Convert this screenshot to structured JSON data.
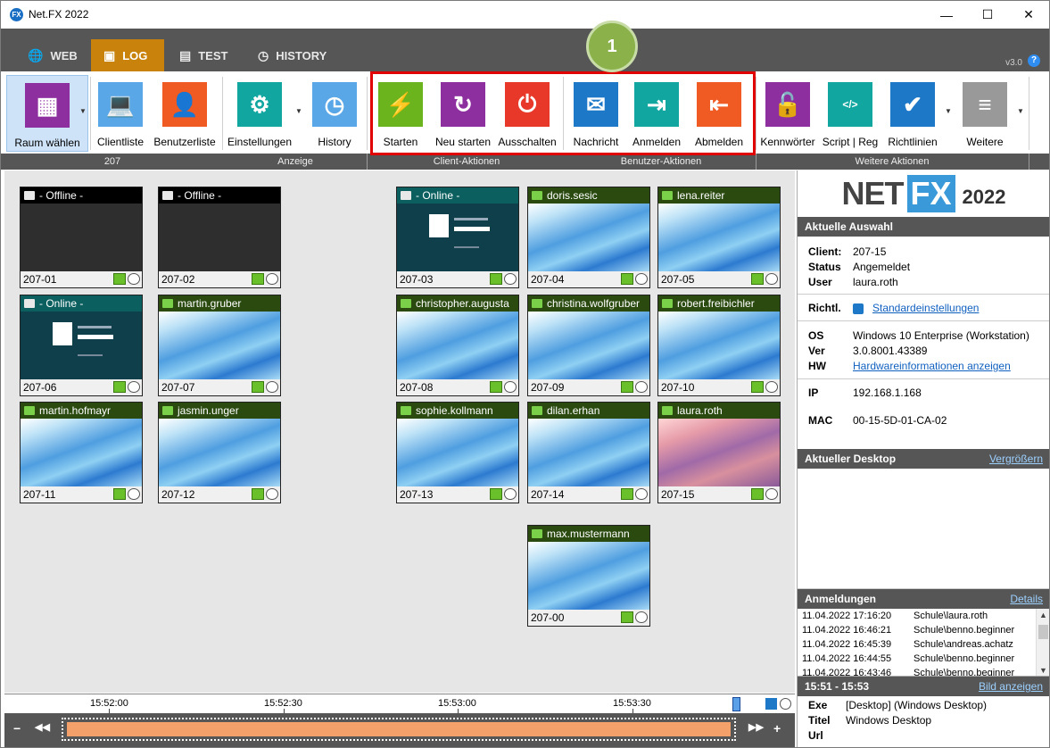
{
  "window": {
    "title": "Net.FX 2022",
    "icon": "netfx-app-icon"
  },
  "window_controls": {
    "minimize": "—",
    "maximize": "☐",
    "close": "✕"
  },
  "tabs": [
    {
      "label": "WEB",
      "icon": "globe-icon",
      "active": false
    },
    {
      "label": "LOG",
      "icon": "log-icon",
      "active": true
    },
    {
      "label": "TEST",
      "icon": "test-icon",
      "active": false
    },
    {
      "label": "HISTORY",
      "icon": "history-icon",
      "active": false
    }
  ],
  "version": "v3.0",
  "help": "?",
  "callout_badge": "1",
  "ribbon": {
    "buttons": [
      {
        "label": "Raum wählen",
        "icon": "room-icon",
        "color": "#8e2fa0"
      },
      {
        "label": "Clientliste",
        "icon": "laptop-icon",
        "color": "#5aa7e8"
      },
      {
        "label": "Benutzerliste",
        "icon": "user-icon",
        "color": "#f05a23"
      },
      {
        "label": "Einstellungen",
        "icon": "gears-icon",
        "color": "#11a6a0"
      },
      {
        "label": "History",
        "icon": "history-globe-icon",
        "color": "#5aa7e8"
      },
      {
        "label": "Starten",
        "icon": "lightning-icon",
        "color": "#6cb41e"
      },
      {
        "label": "Neu starten",
        "icon": "restart-icon",
        "color": "#8e2fa0"
      },
      {
        "label": "Ausschalten",
        "icon": "power-icon",
        "color": "#e8382a"
      },
      {
        "label": "Nachricht",
        "icon": "envelope-icon",
        "color": "#1e78c8"
      },
      {
        "label": "Anmelden",
        "icon": "login-icon",
        "color": "#11a6a0"
      },
      {
        "label": "Abmelden",
        "icon": "logout-icon",
        "color": "#f05a23"
      },
      {
        "label": "Kennwörter",
        "icon": "lock-icon",
        "color": "#8e2fa0"
      },
      {
        "label": "Script | Reg",
        "icon": "code-icon",
        "color": "#11a6a0"
      },
      {
        "label": "Richtlinien",
        "icon": "shield-check-icon",
        "color": "#1e78c8"
      },
      {
        "label": "Weitere",
        "icon": "menu-icon",
        "color": "#999999"
      }
    ],
    "groups": [
      "207",
      "Anzeige",
      "Client-Aktionen",
      "Benutzer-Aktionen",
      "Weitere Aktionen"
    ]
  },
  "clients": [
    {
      "id": "207-01",
      "header": "- Offline -",
      "state": "offline",
      "screen": "dark"
    },
    {
      "id": "207-02",
      "header": "- Offline -",
      "state": "offline",
      "screen": "dark"
    },
    {
      "id": "207-03",
      "header": "- Online -",
      "state": "online",
      "screen": "teal"
    },
    {
      "id": "207-04",
      "header": "doris.sesic",
      "state": "user",
      "screen": "blue"
    },
    {
      "id": "207-05",
      "header": "lena.reiter",
      "state": "user",
      "screen": "blue"
    },
    {
      "id": "207-06",
      "header": "- Online -",
      "state": "online",
      "screen": "teal"
    },
    {
      "id": "207-07",
      "header": "martin.gruber",
      "state": "user",
      "screen": "blue"
    },
    {
      "id": "207-08",
      "header": "christopher.augusta",
      "state": "user",
      "screen": "blue"
    },
    {
      "id": "207-09",
      "header": "christina.wolfgruber",
      "state": "user",
      "screen": "blue"
    },
    {
      "id": "207-10",
      "header": "robert.freibichler",
      "state": "user",
      "screen": "blue"
    },
    {
      "id": "207-11",
      "header": "martin.hofmayr",
      "state": "user",
      "screen": "blue"
    },
    {
      "id": "207-12",
      "header": "jasmin.unger",
      "state": "user",
      "screen": "blue"
    },
    {
      "id": "207-13",
      "header": "sophie.kollmann",
      "state": "user",
      "screen": "blue"
    },
    {
      "id": "207-14",
      "header": "dilan.erhan",
      "state": "user",
      "screen": "blue"
    },
    {
      "id": "207-15",
      "header": "laura.roth",
      "state": "user",
      "screen": "pink"
    },
    {
      "id": "207-00",
      "header": "max.mustermann",
      "state": "user",
      "screen": "blue"
    }
  ],
  "panel": {
    "logo": {
      "part1": "NET",
      "part2": "FX",
      "part3": "2022"
    },
    "current_selection": {
      "header": "Aktuelle Auswahl",
      "client_label": "Client:",
      "client": "207-15",
      "status_label": "Status",
      "status": "Angemeldet",
      "user_label": "User",
      "user": "laura.roth",
      "richtl_label": "Richtl.",
      "richtl": "Standardeinstellungen",
      "os_label": "OS",
      "os": "Windows 10 Enterprise (Workstation)",
      "ver_label": "Ver",
      "ver": "3.0.8001.43389",
      "hw_label": "HW",
      "hw": "Hardwareinformationen anzeigen",
      "ip_label": "IP",
      "ip": "192.168.1.168",
      "mac_label": "MAC",
      "mac": "00-15-5D-01-CA-02"
    },
    "desktop": {
      "header": "Aktueller Desktop",
      "link": "Vergrößern"
    },
    "logins": {
      "header": "Anmeldungen",
      "link": "Details",
      "rows": [
        {
          "time": "11.04.2022 17:16:20",
          "user": "Schule\\laura.roth"
        },
        {
          "time": "11.04.2022 16:46:21",
          "user": "Schule\\benno.beginner"
        },
        {
          "time": "11.04.2022 16:45:39",
          "user": "Schule\\andreas.achatz"
        },
        {
          "time": "11.04.2022 16:44:55",
          "user": "Schule\\benno.beginner"
        },
        {
          "time": "11.04.2022 16:43:46",
          "user": "Schule\\benno.beginner"
        }
      ]
    },
    "history": {
      "range": "15:51 - 15:53",
      "link": "Bild anzeigen",
      "exe_label": "Exe",
      "exe": "[Desktop] (Windows Desktop)",
      "titel_label": "Titel",
      "titel": "Windows Desktop",
      "url_label": "Url",
      "url": ""
    }
  },
  "timeline": {
    "ticks": [
      "15:52:00",
      "15:52:30",
      "15:53:00",
      "15:53:30"
    ],
    "zoom_out": "−",
    "rewind": "◀◀",
    "forward": "▶▶",
    "zoom_in": "+"
  }
}
